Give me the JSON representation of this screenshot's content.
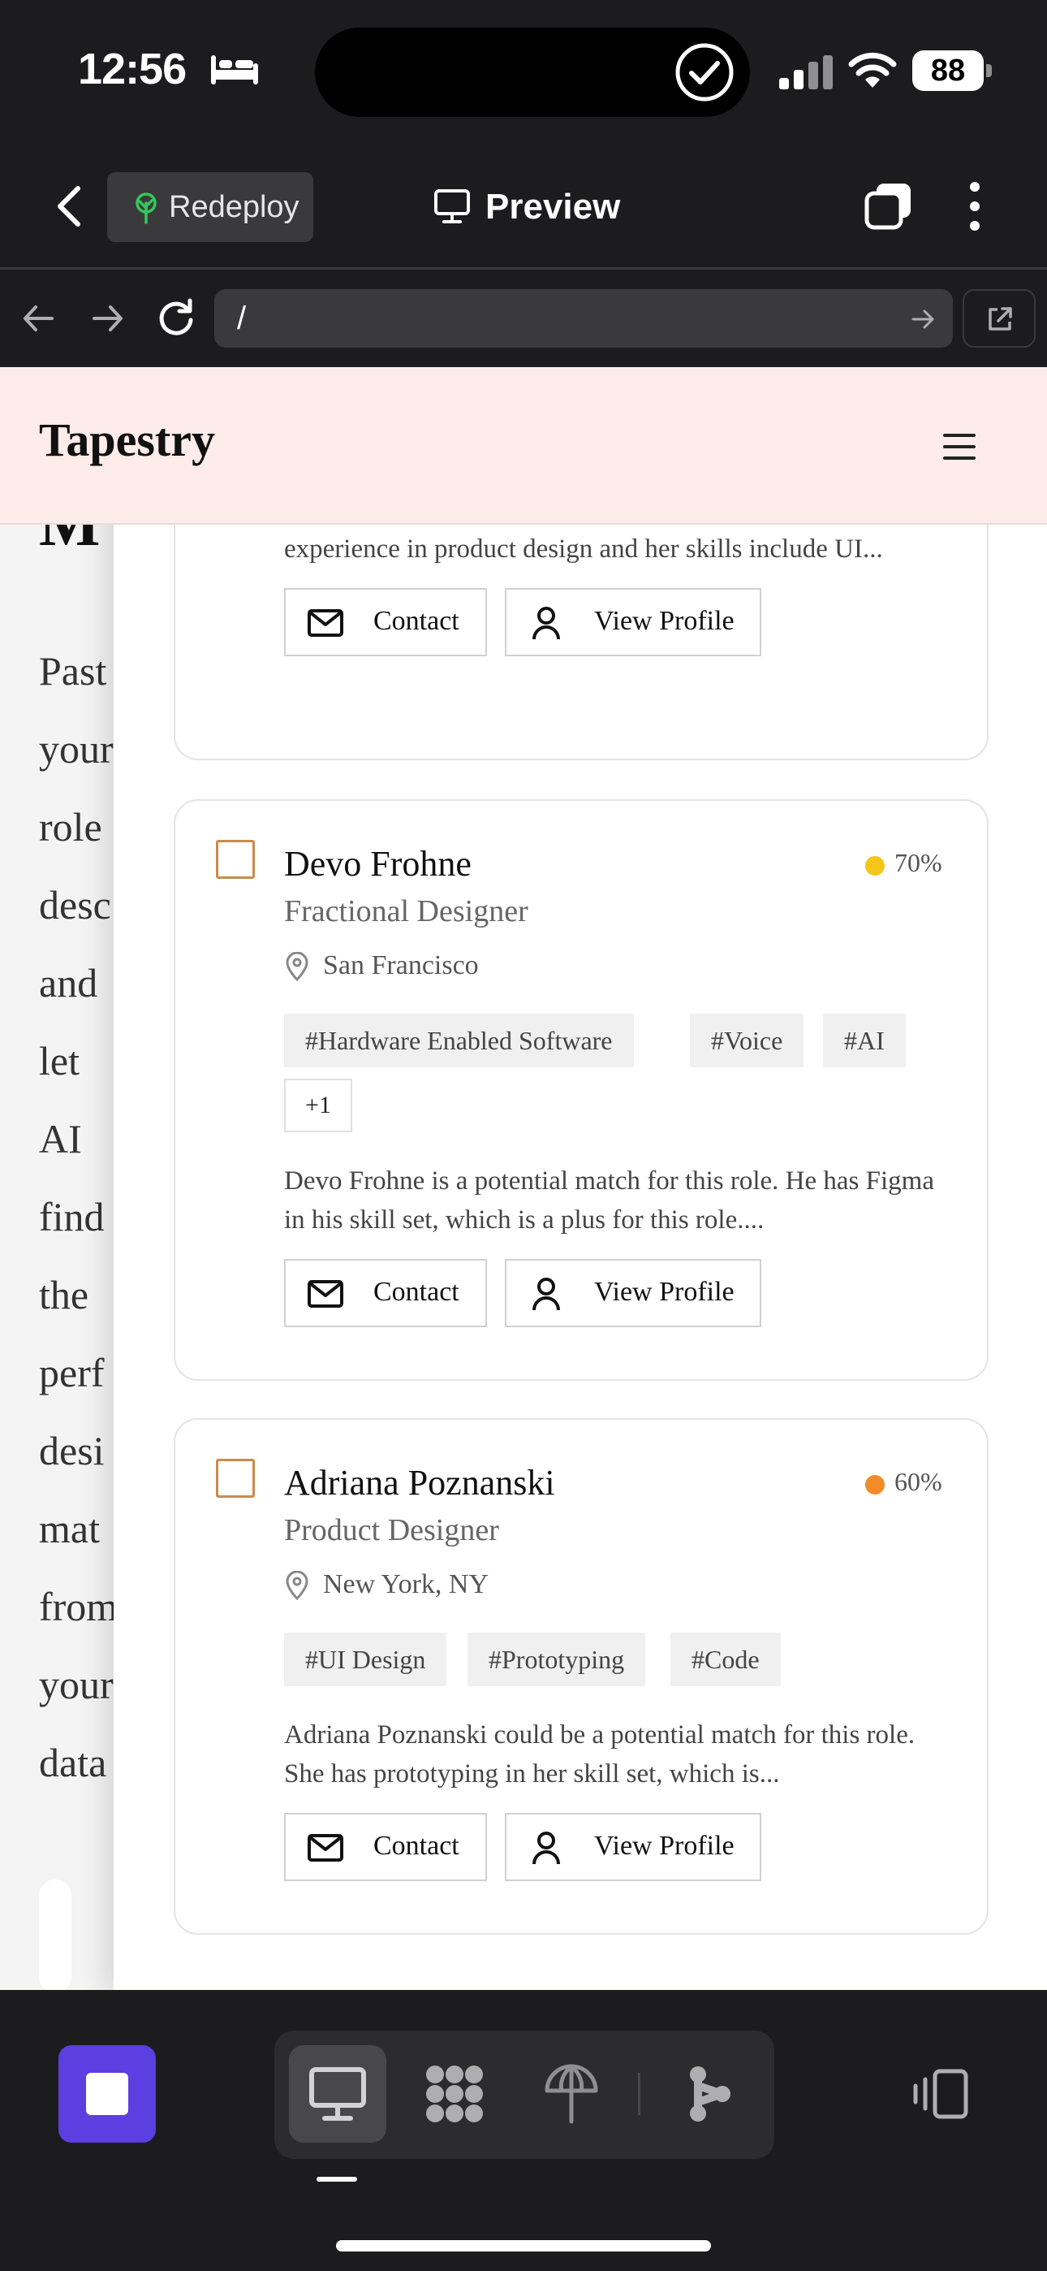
{
  "status_bar": {
    "time": "12:56",
    "battery": "88"
  },
  "app_header": {
    "redeploy_label": "Redeploy",
    "preview_label": "Preview"
  },
  "url_bar": {
    "url": "/"
  },
  "site": {
    "logo": "Tapestry"
  },
  "background_page": {
    "heading_fragment": "M",
    "words": [
      "Past",
      "your",
      "role",
      "desc",
      "and",
      "let",
      "AI",
      "find",
      "the",
      "perf",
      "desi",
      "mat",
      "from",
      "your",
      "data"
    ]
  },
  "candidates": [
    {
      "name": "",
      "role": "",
      "location": "",
      "tags": [],
      "summary": "Adrianne Ngam is a strong match for this role. She has experience in product design and her skills include UI...",
      "contact_label": "Contact",
      "profile_label": "View Profile"
    },
    {
      "name": "Devo Frohne",
      "role": "Fractional Designer",
      "score": "70%",
      "score_color": "#f5c518",
      "location": "San Francisco",
      "tags": [
        "#Hardware Enabled Software",
        "#Voice",
        "#AI"
      ],
      "tags_more": "+1",
      "summary": "Devo Frohne is a potential match for this role. He has Figma in his skill set, which is a plus for this role....",
      "contact_label": "Contact",
      "profile_label": "View Profile"
    },
    {
      "name": "Adriana Poznanski",
      "role": "Product Designer",
      "score": "60%",
      "score_color": "#f28c28",
      "location": "New York, NY",
      "tags": [
        "#UI Design",
        "#Prototyping",
        "#Code"
      ],
      "summary": "Adriana Poznanski could be a potential match for this role. She has prototyping in her skill set, which is...",
      "contact_label": "Contact",
      "profile_label": "View Profile"
    }
  ],
  "icons": {
    "status": [
      "bed-icon",
      "check-circle-icon",
      "signal-icon",
      "wifi-icon"
    ],
    "header": [
      "back-chevron-icon",
      "sprout-icon",
      "monitor-icon",
      "tabs-icon",
      "more-vertical-icon"
    ],
    "toolbar": [
      "monitor-icon",
      "apps-grid-icon",
      "deploy-icon",
      "share-icon",
      "devices-icon"
    ]
  },
  "colors": {
    "accent": "#5b3fe0",
    "site_header_bg": "#fdecea",
    "checkbox": "#c98b4a"
  }
}
